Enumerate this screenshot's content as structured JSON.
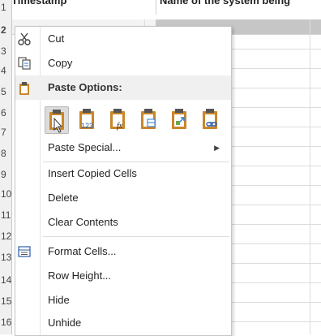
{
  "sheet": {
    "header_a": "Timestamp",
    "header_b": "Name of the system being",
    "row_numbers": [
      "1",
      "2",
      "3",
      "4",
      "5",
      "6",
      "7",
      "8",
      "9",
      "10",
      "11",
      "12",
      "13",
      "14",
      "15",
      "16"
    ]
  },
  "menu": {
    "cut": "Cut",
    "copy": "Copy",
    "paste_options": "Paste Options:",
    "paste_icons": [
      {
        "name": "paste-icon",
        "badge": ""
      },
      {
        "name": "paste-values-icon",
        "badge": "123"
      },
      {
        "name": "paste-formulas-icon",
        "badge": "fx"
      },
      {
        "name": "paste-formatting-icon",
        "badge": ""
      },
      {
        "name": "paste-transpose-icon",
        "badge": ""
      },
      {
        "name": "paste-link-icon",
        "badge": ""
      }
    ],
    "paste_special": "Paste Special...",
    "insert_copied": "Insert Copied Cells",
    "delete": "Delete",
    "clear_contents": "Clear Contents",
    "format_cells": "Format Cells...",
    "row_height": "Row Height...",
    "hide": "Hide",
    "unhide": "Unhide"
  },
  "colors": {
    "accent": "#217346",
    "clipboard": "#c8862a",
    "menu_hover": "#f0f0f0"
  }
}
